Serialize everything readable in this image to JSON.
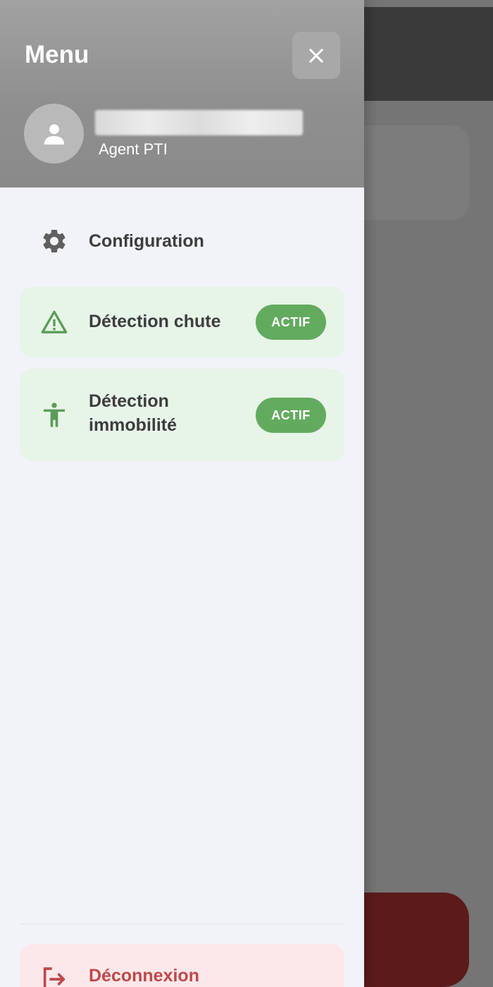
{
  "header": {
    "title": "Menu",
    "close_icon": "close-icon",
    "avatar_icon": "person-icon",
    "user_name": "",
    "user_role": "Agent PTI"
  },
  "menu": {
    "items": [
      {
        "label": "Configuration",
        "icon": "gear-icon"
      },
      {
        "label": "Détection chute",
        "icon": "warning-icon",
        "status": "ACTIF"
      },
      {
        "label": "Détection\nimmobilité",
        "icon": "person-standing-icon",
        "status": "ACTIF"
      }
    ]
  },
  "footer": {
    "logout_label": "Déconnexion",
    "logout_icon": "logout-icon"
  },
  "colors": {
    "active_badge": "#62ab5e",
    "active_item_bg": "#e7f4e8",
    "logout_text": "#c0484a",
    "logout_bg": "#fce8ea"
  }
}
